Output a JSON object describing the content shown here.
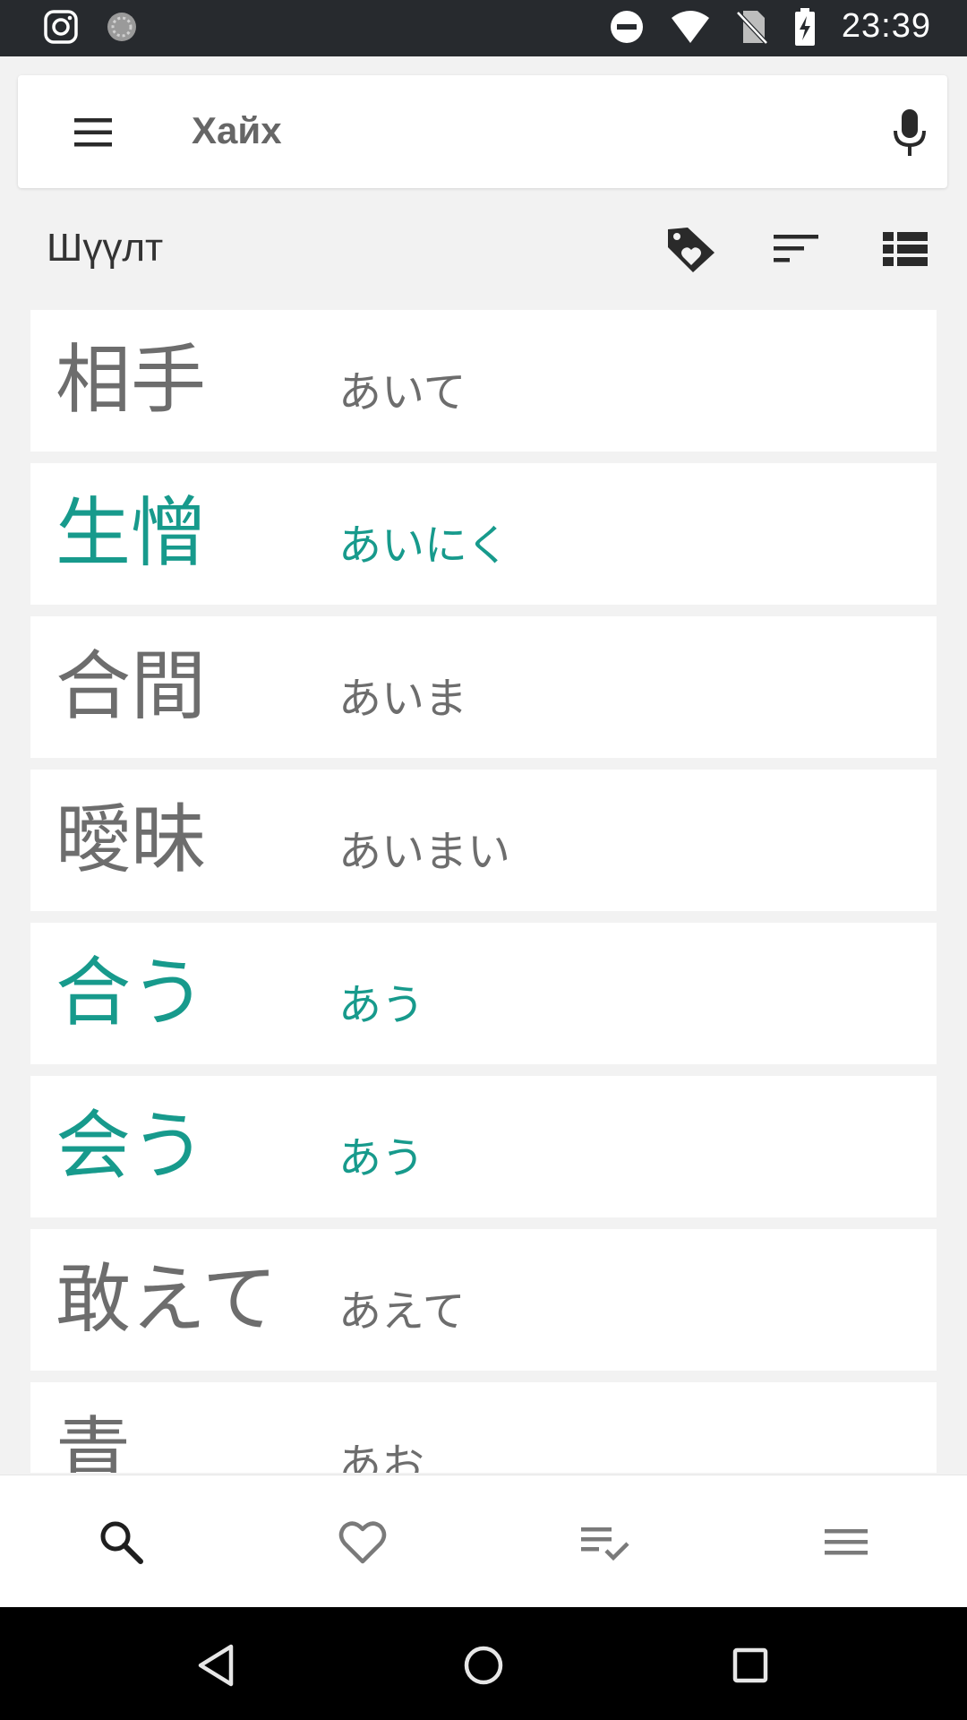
{
  "status_bar": {
    "time": "23:39",
    "icons": [
      "instagram-icon",
      "loading-icon",
      "do-not-disturb-icon",
      "wifi-icon",
      "no-sim-icon",
      "battery-charging-icon"
    ]
  },
  "search": {
    "title": "Хайх",
    "menu_icon": "hamburger-menu-icon",
    "mic_icon": "microphone-icon"
  },
  "filter": {
    "label": "Шүүлт",
    "icons": [
      "tag-heart-icon",
      "sort-icon",
      "list-view-icon"
    ]
  },
  "colors": {
    "accent": "#179a8c",
    "text": "#6d6d6d",
    "status_bar": "#272a2e"
  },
  "words": [
    {
      "kanji": "相手",
      "kana": "あいて",
      "highlight": false
    },
    {
      "kanji": "生憎",
      "kana": "あいにく",
      "highlight": true
    },
    {
      "kanji": "合間",
      "kana": "あいま",
      "highlight": false
    },
    {
      "kanji": "曖昧",
      "kana": "あいまい",
      "highlight": false
    },
    {
      "kanji": "合う",
      "kana": "あう",
      "highlight": true
    },
    {
      "kanji": "会う",
      "kana": "あう",
      "highlight": true
    },
    {
      "kanji": "敢えて",
      "kana": "あえて",
      "highlight": false
    },
    {
      "kanji": "青",
      "kana": "あお",
      "highlight": false
    }
  ],
  "bottom_nav": {
    "items": [
      "search-icon",
      "heart-icon",
      "checklist-icon",
      "menu-icon"
    ],
    "active": 0
  },
  "system_nav": [
    "back-icon",
    "home-icon",
    "recents-icon"
  ]
}
